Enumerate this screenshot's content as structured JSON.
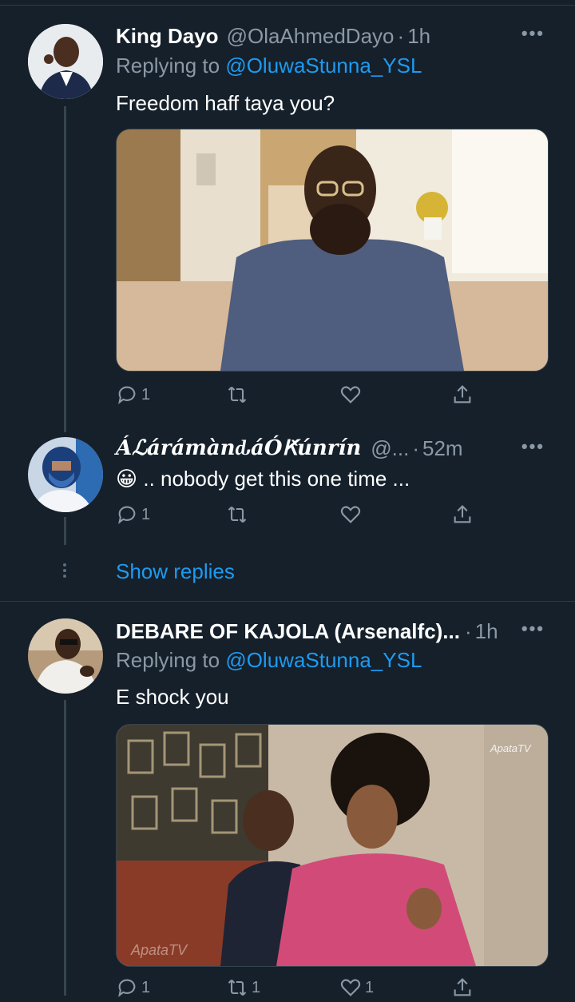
{
  "tweets": [
    {
      "name": "King Dayo",
      "handle": "@OlaAhmedDayo",
      "time": "1h",
      "replying_prefix": "Replying to",
      "replying_to": "@OluwaStunna_YSL",
      "text": "Freedom haff taya you?",
      "actions": {
        "reply_count": "1",
        "retweet_count": "",
        "like_count": ""
      }
    },
    {
      "name": "ÁℒárámànԃáÓԞúnrín",
      "handle": "@...",
      "time": "52m",
      "emoji": "😀",
      "text": ".. nobody get this one time ...",
      "actions": {
        "reply_count": "1",
        "retweet_count": "",
        "like_count": ""
      },
      "show_replies": "Show replies"
    },
    {
      "name": "DEBARE OF KAJOLA (Arsenalfc)...",
      "handle": "",
      "time": "1h",
      "replying_prefix": "Replying to",
      "replying_to": "@OluwaStunna_YSL",
      "text": "E shock you",
      "media_watermark": "ApataTV",
      "actions": {
        "reply_count": "1",
        "retweet_count": "1",
        "like_count": "1"
      }
    }
  ],
  "icons": [
    "more-icon",
    "reply-icon",
    "retweet-icon",
    "like-icon",
    "share-icon"
  ],
  "colors": {
    "background": "#15202b",
    "link": "#1d9bf0",
    "muted": "#8b98a5",
    "divider": "#2f3b47"
  }
}
